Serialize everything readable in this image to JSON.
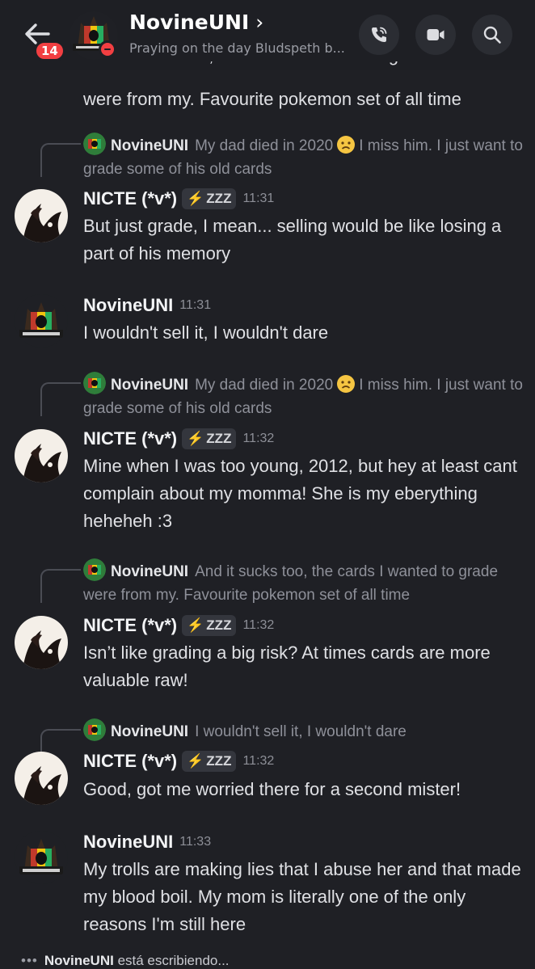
{
  "header": {
    "back_label": "Back",
    "unread_count": "14",
    "title": "NovineUNI",
    "chevron": "›",
    "status": "Praying on the day Bludspeth b...",
    "icons": {
      "back": "arrow-left-icon",
      "call": "phone-call-icon",
      "video": "video-camera-icon",
      "search": "search-icon"
    }
  },
  "messages": {
    "cutoff": {
      "top_partial": "And it sucks too, the cards I wanted to grade",
      "line": "were from my. Favourite pokemon set of all time"
    },
    "m1": {
      "reply_author": "NovineUNI",
      "reply_text_a": "My dad died in 2020",
      "reply_text_b": "I miss him. I just want to grade some of his old cards",
      "author": "NICTE (*v*)",
      "tag_icon": "⚡",
      "tag": "ZZZ",
      "time": "11:31",
      "text": "But just grade, I mean... selling would be like losing a part of his memory"
    },
    "m2": {
      "author": "NovineUNI",
      "time": "11:31",
      "text": "I wouldn't sell it, I wouldn't dare"
    },
    "m3": {
      "reply_author": "NovineUNI",
      "reply_text_a": "My dad died in 2020",
      "reply_text_b": "I miss him. I just want to grade some of his old cards",
      "author": "NICTE (*v*)",
      "tag_icon": "⚡",
      "tag": "ZZZ",
      "time": "11:32",
      "text": "Mine when I was too young, 2012, but hey at least cant complain about my momma! She is my eberything heheheh :3"
    },
    "m4": {
      "reply_author": "NovineUNI",
      "reply_text": "And it sucks too, the cards I wanted to grade were from my. Favourite pokemon set of all time",
      "author": "NICTE (*v*)",
      "tag_icon": "⚡",
      "tag": "ZZZ",
      "time": "11:32",
      "text": "Isn’t like grading a big risk? At times cards are more valuable raw!"
    },
    "m5": {
      "reply_author": "NovineUNI",
      "reply_text": "I wouldn't sell it, I wouldn't dare",
      "author": "NICTE (*v*)",
      "tag_icon": "⚡",
      "tag": "ZZZ",
      "time": "11:32",
      "text": "Good, got me worried there for a second mister!"
    },
    "m6": {
      "author": "NovineUNI",
      "time": "11:33",
      "text": "My trolls are making lies that I abuse her and that made my blood boil. My mom is literally one of the only reasons I'm still here"
    }
  },
  "typing": {
    "dots": "•••",
    "user": "NovineUNI",
    "text": "está escribiendo..."
  },
  "colors": {
    "background": "#1f2025",
    "badge": "#f23f42",
    "text": "#dfe0e4",
    "muted": "#8e9099"
  }
}
